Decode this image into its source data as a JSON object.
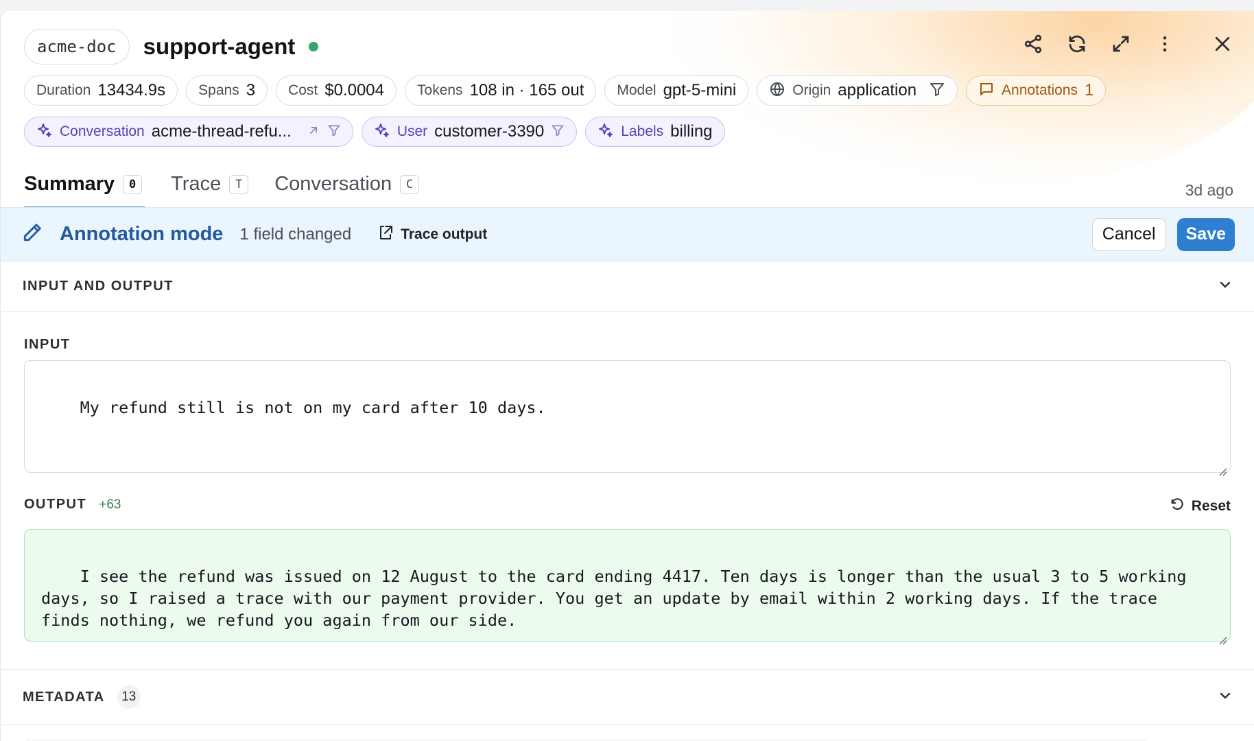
{
  "header": {
    "project": "acme-doc",
    "agent_name": "support-agent",
    "status_color": "#36a56a",
    "icons": [
      "share-icon",
      "refresh-icon",
      "expand-icon",
      "more-vertical-icon",
      "close-icon"
    ]
  },
  "chips": {
    "duration": {
      "key": "Duration",
      "value": "13434.9s"
    },
    "spans": {
      "key": "Spans",
      "value": "3"
    },
    "cost": {
      "key": "Cost",
      "value": "$0.0004"
    },
    "tokens": {
      "key": "Tokens",
      "value": "108 in · 165 out"
    },
    "model": {
      "key": "Model",
      "value": "gpt-5-mini"
    },
    "origin": {
      "key": "Origin",
      "value": "application"
    },
    "annotations": {
      "key": "Annotations",
      "value": "1"
    },
    "conversation": {
      "key": "Conversation",
      "value": "acme-thread-refu..."
    },
    "user": {
      "key": "User",
      "value": "customer-3390"
    },
    "labels": {
      "key": "Labels",
      "value": "billing"
    }
  },
  "tabs": [
    {
      "label": "Summary",
      "shortcut": "0",
      "active": true
    },
    {
      "label": "Trace",
      "shortcut": "T",
      "active": false
    },
    {
      "label": "Conversation",
      "shortcut": "C",
      "active": false
    }
  ],
  "time_ago": "3d ago",
  "annotation_bar": {
    "title": "Annotation mode",
    "changed": "1 field changed",
    "trace_link": "Trace output",
    "cancel": "Cancel",
    "save": "Save",
    "accent": "#2f7fd1"
  },
  "sections": {
    "io": {
      "title": "INPUT AND OUTPUT"
    },
    "input": {
      "label": "INPUT",
      "value": "My refund still is not on my card after 10 days."
    },
    "output": {
      "label": "OUTPUT",
      "diff": "+63",
      "reset": "Reset",
      "value": "I see the refund was issued on 12 August to the card ending 4417. Ten days is longer than the usual 3 to 5 working days, so I raised a trace with our payment provider. You get an update by email within 2 working days. If the trace finds nothing, we refund you again from our side."
    },
    "metadata": {
      "title": "METADATA",
      "count": "13"
    }
  }
}
